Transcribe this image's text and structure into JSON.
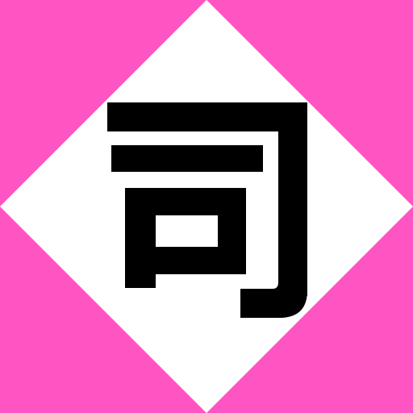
{
  "sign": {
    "glyph": "司",
    "glyph_name": "kanji-tsukasa",
    "background_color": "#ff55c3",
    "diamond_color": "#ffffff",
    "glyph_color": "#000000"
  }
}
